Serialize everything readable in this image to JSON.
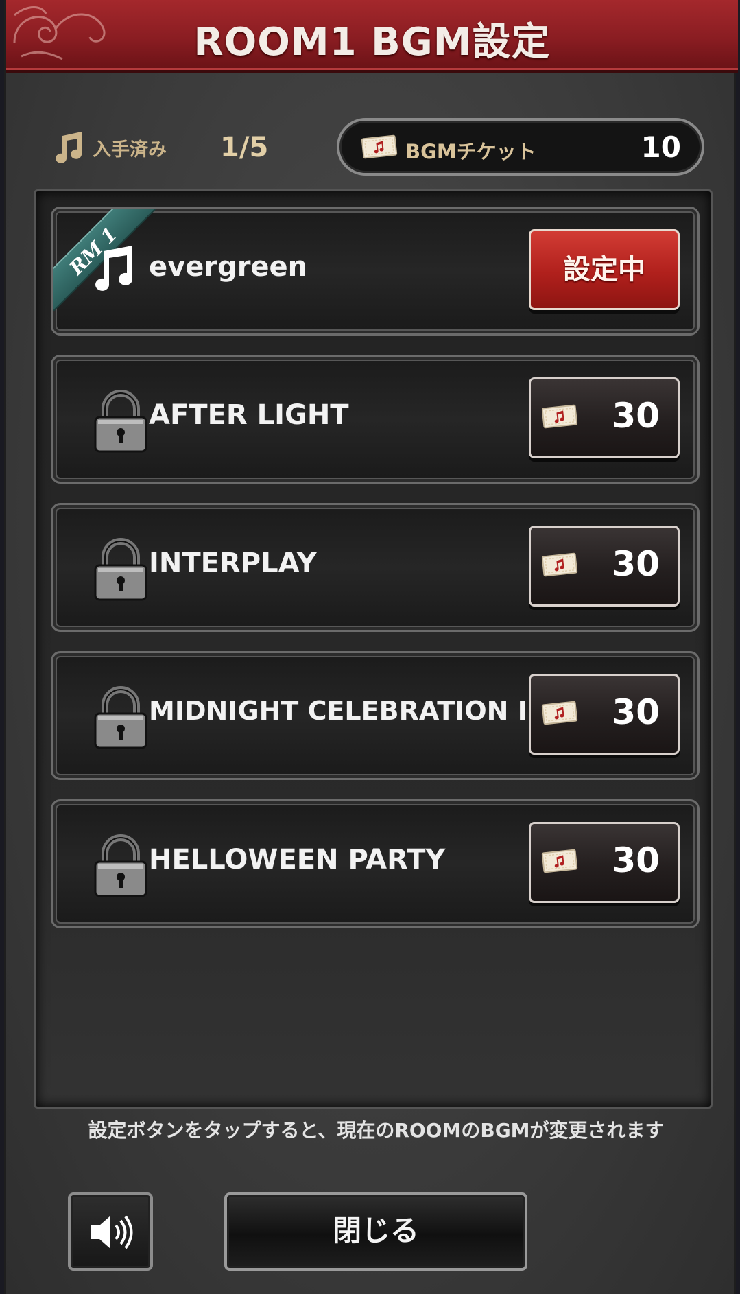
{
  "header": {
    "title": "ROOM1 BGM設定"
  },
  "status": {
    "owned_label": "入手済み",
    "owned_value": "1/5",
    "ticket_label": "BGMチケット",
    "ticket_count": "10"
  },
  "tracks": [
    {
      "name": "evergreen",
      "state": "set",
      "badge": "RM 1",
      "button_label": "設定中"
    },
    {
      "name": "AFTER LIGHT",
      "state": "locked",
      "cost": "30"
    },
    {
      "name": "INTERPLAY",
      "state": "locked",
      "cost": "30"
    },
    {
      "name": "MIDNIGHT CELEBRATION II",
      "state": "locked",
      "cost": "30"
    },
    {
      "name": "HELLOWEEN PARTY",
      "state": "locked",
      "cost": "30"
    }
  ],
  "footer": {
    "hint": "設定ボタンをタップすると、現在のROOMのBGMが変更されます",
    "close_label": "閉じる",
    "sound_icon": "speaker-icon"
  },
  "colors": {
    "title_red": "#a4282c",
    "set_button_red": "#c52d27",
    "ribbon_teal": "#3a7470",
    "gold_text": "#cbb48a"
  }
}
